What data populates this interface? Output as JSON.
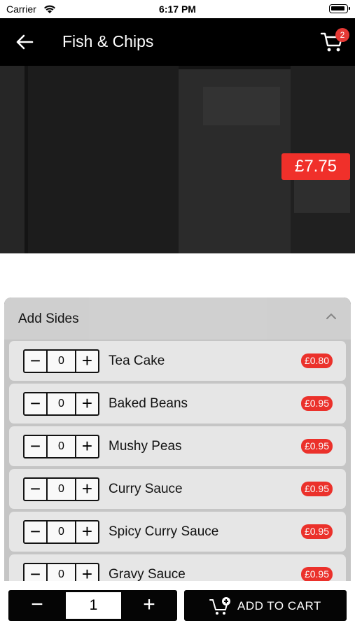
{
  "status": {
    "carrier": "Carrier",
    "time": "6:17 PM"
  },
  "header": {
    "title": "Fish & Chips",
    "cart_count": "2"
  },
  "hero": {
    "price": "£7.75"
  },
  "sides": {
    "title": "Add Sides",
    "items": [
      {
        "name": "Tea Cake",
        "qty": "0",
        "price": "£0.80"
      },
      {
        "name": "Baked Beans",
        "qty": "0",
        "price": "£0.95"
      },
      {
        "name": "Mushy Peas",
        "qty": "0",
        "price": "£0.95"
      },
      {
        "name": "Curry Sauce",
        "qty": "0",
        "price": "£0.95"
      },
      {
        "name": "Spicy Curry Sauce",
        "qty": "0",
        "price": "£0.95"
      },
      {
        "name": "Gravy Sauce",
        "qty": "0",
        "price": "£0.95"
      }
    ]
  },
  "bottom": {
    "quantity": "1",
    "minus": "−",
    "plus": "+",
    "add_to_cart": "ADD TO CART"
  },
  "colors": {
    "accent": "#f0302a",
    "header_bg": "#000000"
  },
  "icons": [
    "wifi-icon",
    "battery-icon",
    "back-arrow-icon",
    "cart-icon",
    "chevron-up-icon",
    "add-to-cart-icon"
  ]
}
